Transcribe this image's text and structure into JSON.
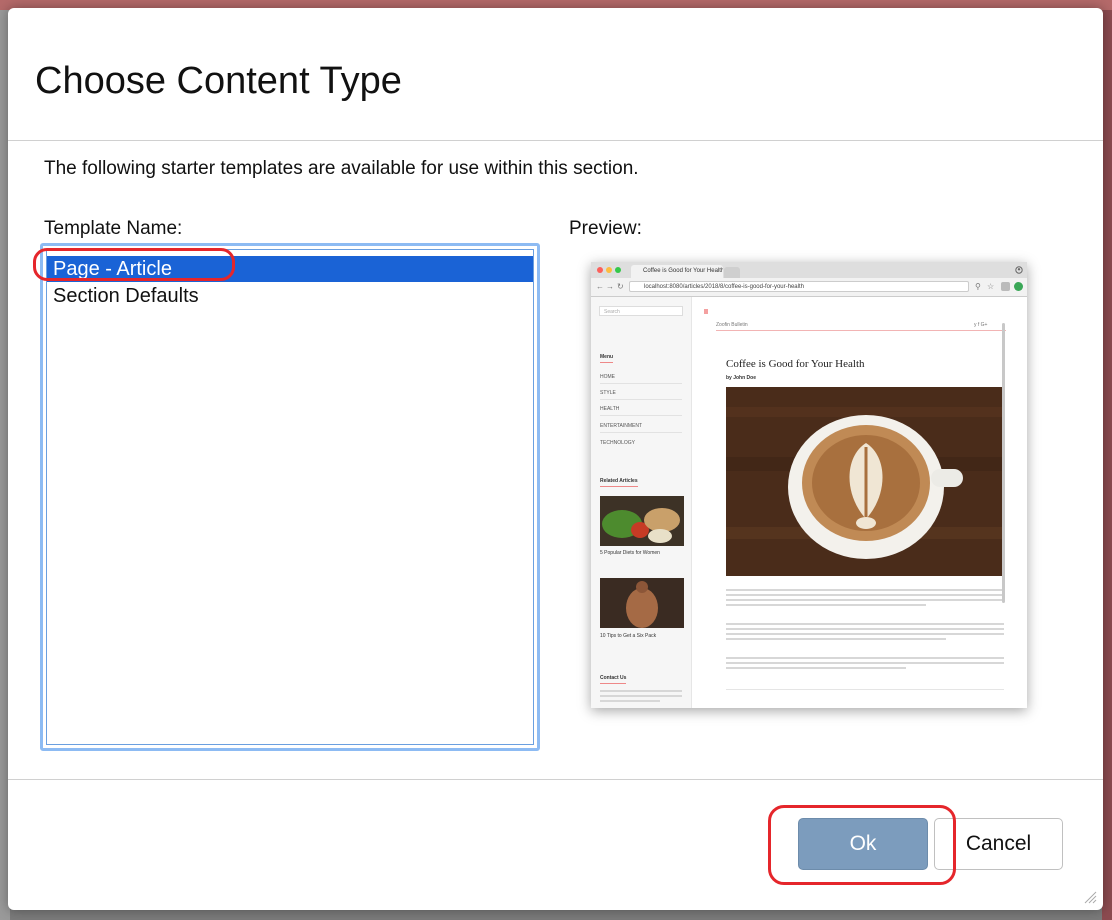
{
  "dialog": {
    "title": "Choose Content Type",
    "intro": "The following starter templates are available for use within this section.",
    "template_label": "Template Name:",
    "preview_label": "Preview:",
    "templates": [
      {
        "label": "Page - Article",
        "selected": true
      },
      {
        "label": "Section Defaults",
        "selected": false
      }
    ],
    "ok_label": "Ok",
    "cancel_label": "Cancel"
  },
  "preview": {
    "tab_title": "Coffee is Good for Your Health",
    "url": "localhost:8080/articles/2018/8/coffee-is-good-for-your-health",
    "search_placeholder": "Search",
    "site_name": "Zoofin Bulletin",
    "social": "y f G+",
    "menu_heading": "Menu",
    "menu_items": [
      "HOME",
      "STYLE",
      "HEALTH",
      "ENTERTAINMENT",
      "TECHNOLOGY"
    ],
    "related_heading": "Related Articles",
    "related_articles": [
      "5 Popular Diets for Women",
      "10 Tips to Get a Six Pack"
    ],
    "contact_heading": "Contact Us",
    "article_title": "Coffee is Good for Your Health",
    "byline": "by John Doe"
  },
  "colors": {
    "selection": "#1a63d6",
    "ok_button": "#7c9cbd",
    "annotation": "#e5262b",
    "listbox_focus": "#8dbbf3"
  }
}
